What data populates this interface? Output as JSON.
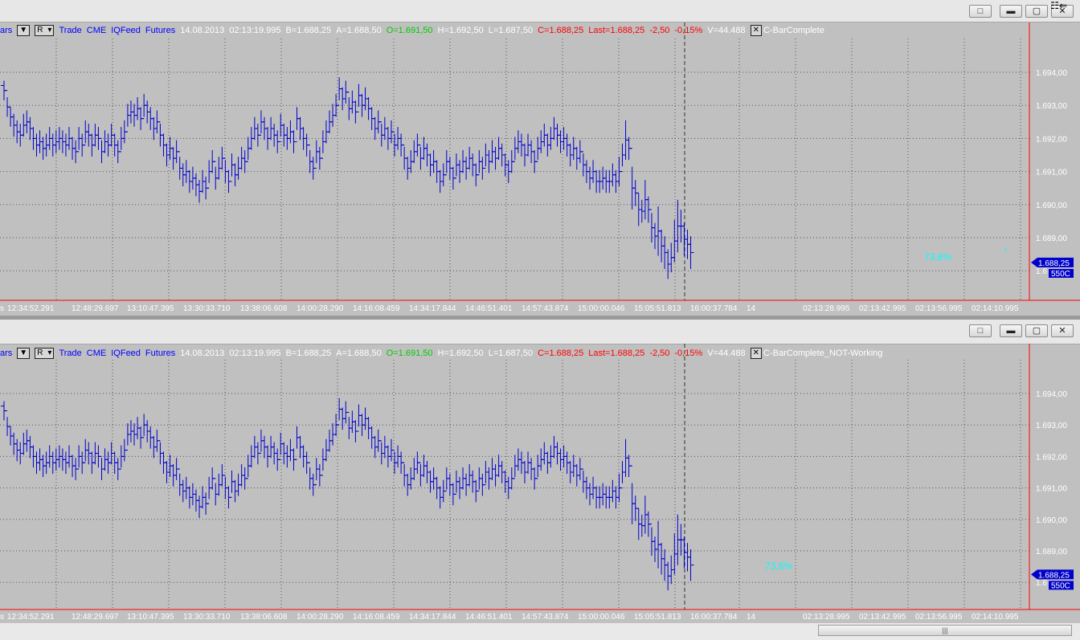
{
  "windows": [
    {
      "strategy_label": "C-BarComplete",
      "header": {
        "bars_label": "ars",
        "r_label": "R",
        "instrument": [
          "Trade",
          "CME",
          "IQFeed",
          "Futures"
        ],
        "date": "14.08.2013",
        "time": "02:13:19.995",
        "bid": "B=1.688,25",
        "ask": "A=1.688,50",
        "open": "O=1.691,50",
        "high": "H=1.692,50",
        "low": "L=1.687,50",
        "close": "C=1.688,25",
        "last": "Last=1.688,25",
        "change": "-2,50",
        "change_pct": "-0,15%",
        "volume": "V=44.488"
      },
      "price_tag": "1.688,25",
      "volume_tag": "550C",
      "percent_label": "73,6%"
    },
    {
      "strategy_label": "C-BarComplete_NOT-Working",
      "header": {
        "bars_label": "ars",
        "r_label": "R",
        "instrument": [
          "Trade",
          "CME",
          "IQFeed",
          "Futures"
        ],
        "date": "14.08.2013",
        "time": "02:13:19.995",
        "bid": "B=1.688,25",
        "ask": "A=1.688,50",
        "open": "O=1.691,50",
        "high": "H=1.692,50",
        "low": "L=1.687,50",
        "close": "C=1.688,25",
        "last": "Last=1.688,25",
        "change": "-2,50",
        "change_pct": "-0,15%",
        "volume": "V=44.488"
      },
      "price_tag": "1.688,25",
      "volume_tag": "550C",
      "percent_label": "73,6%"
    }
  ],
  "titlebar_icons": [
    "restore-icon",
    "minimize-icon",
    "maximize-icon",
    "close-icon"
  ],
  "colors": {
    "background": "#c0c0c0",
    "bars": "#0000cc",
    "axis": "#ff0000",
    "text_blue": "#0000ff",
    "text_green": "#00cc00",
    "text_red": "#ff0000",
    "text_white": "#ffffff",
    "percent": "#00ffff",
    "tag_bg": "#0000cc"
  },
  "chart_data": [
    {
      "type": "ohlc",
      "ylim": [
        1687.5,
        1694.4
      ],
      "y_ticks": [
        1689.0,
        1690.0,
        1691.0,
        1692.0,
        1693.0,
        1694.0
      ],
      "y_tick_labels": [
        "1.689,00",
        "1.690,00",
        "1.691,00",
        "1.692,00",
        "1.693,00",
        "1.694,00"
      ],
      "partial_tick_label": "1.6",
      "x_labels": [
        "12:34:52.291",
        "12:48:29.697",
        "13:10:47.395",
        "13:30:33.710",
        "13:38:06.608",
        "14:00:28.290",
        "14:16:08.459",
        "14:34:17.844",
        "14:46:51.401",
        "14:57:43.874",
        "15:00:00.046",
        "15:05:51.813",
        "16:00:37.784",
        "14",
        "02:13:28.995",
        "02:13:42.995",
        "02:13:56.995",
        "02:14:10.995"
      ],
      "x_label_prefix": "s",
      "session_break_after_bar": 121,
      "grid": true,
      "bars": [
        [
          1693.6,
          1693.3
        ],
        [
          1693.1,
          1692.8
        ],
        [
          1692.8,
          1692.5
        ],
        [
          1692.6,
          1692.2
        ],
        [
          1692.4,
          1692.0
        ],
        [
          1692.3,
          1691.9
        ],
        [
          1692.6,
          1692.2
        ],
        [
          1692.7,
          1692.3
        ],
        [
          1692.5,
          1692.1
        ],
        [
          1692.2,
          1691.8
        ],
        [
          1692.0,
          1691.6
        ],
        [
          1692.1,
          1691.7
        ],
        [
          1691.9,
          1691.5
        ],
        [
          1692.0,
          1691.6
        ],
        [
          1692.2,
          1691.8
        ],
        [
          1692.0,
          1691.6
        ],
        [
          1692.1,
          1691.7
        ],
        [
          1692.2,
          1691.8
        ],
        [
          1692.1,
          1691.7
        ],
        [
          1692.0,
          1691.6
        ],
        [
          1692.2,
          1691.8
        ],
        [
          1691.9,
          1691.5
        ],
        [
          1691.8,
          1691.4
        ],
        [
          1692.2,
          1691.8
        ],
        [
          1692.0,
          1691.6
        ],
        [
          1692.4,
          1692.0
        ],
        [
          1692.3,
          1691.9
        ],
        [
          1692.0,
          1691.6
        ],
        [
          1692.3,
          1691.9
        ],
        [
          1692.2,
          1691.8
        ],
        [
          1691.8,
          1691.4
        ],
        [
          1692.1,
          1691.7
        ],
        [
          1692.0,
          1691.6
        ],
        [
          1692.3,
          1691.9
        ],
        [
          1692.0,
          1691.6
        ],
        [
          1691.8,
          1691.4
        ],
        [
          1692.2,
          1691.8
        ],
        [
          1692.4,
          1692.0
        ],
        [
          1692.9,
          1692.5
        ],
        [
          1693.0,
          1692.6
        ],
        [
          1692.9,
          1692.5
        ],
        [
          1693.1,
          1692.7
        ],
        [
          1692.8,
          1692.4
        ],
        [
          1693.2,
          1692.8
        ],
        [
          1693.0,
          1692.6
        ],
        [
          1692.8,
          1692.4
        ],
        [
          1692.5,
          1692.1
        ],
        [
          1692.7,
          1692.3
        ],
        [
          1692.3,
          1691.9
        ],
        [
          1692.0,
          1691.6
        ],
        [
          1691.7,
          1691.3
        ],
        [
          1691.9,
          1691.5
        ],
        [
          1691.6,
          1691.2
        ],
        [
          1691.8,
          1691.4
        ],
        [
          1691.3,
          1690.9
        ],
        [
          1691.1,
          1690.7
        ],
        [
          1691.2,
          1690.8
        ],
        [
          1690.9,
          1690.5
        ],
        [
          1691.0,
          1690.6
        ],
        [
          1690.8,
          1690.4
        ],
        [
          1690.6,
          1690.2
        ],
        [
          1690.9,
          1690.5
        ],
        [
          1690.7,
          1690.3
        ],
        [
          1691.2,
          1690.8
        ],
        [
          1691.5,
          1691.1
        ],
        [
          1691.0,
          1690.6
        ],
        [
          1691.3,
          1690.9
        ],
        [
          1691.6,
          1691.2
        ],
        [
          1691.2,
          1690.8
        ],
        [
          1690.9,
          1690.5
        ],
        [
          1691.4,
          1691.0
        ],
        [
          1691.1,
          1690.7
        ],
        [
          1691.3,
          1690.9
        ],
        [
          1691.6,
          1691.2
        ],
        [
          1691.5,
          1691.1
        ],
        [
          1691.9,
          1691.5
        ],
        [
          1692.2,
          1691.8
        ],
        [
          1692.5,
          1692.1
        ],
        [
          1692.3,
          1691.9
        ],
        [
          1692.7,
          1692.3
        ],
        [
          1692.5,
          1692.1
        ],
        [
          1692.2,
          1691.8
        ],
        [
          1692.5,
          1692.1
        ],
        [
          1692.3,
          1691.9
        ],
        [
          1692.1,
          1691.7
        ],
        [
          1692.6,
          1692.2
        ],
        [
          1692.3,
          1691.9
        ],
        [
          1692.2,
          1691.8
        ],
        [
          1692.4,
          1692.0
        ],
        [
          1692.1,
          1691.7
        ],
        [
          1692.8,
          1692.4
        ],
        [
          1692.5,
          1692.1
        ],
        [
          1692.2,
          1691.8
        ],
        [
          1692.0,
          1691.6
        ],
        [
          1691.5,
          1691.1
        ],
        [
          1691.3,
          1690.9
        ],
        [
          1691.8,
          1691.4
        ],
        [
          1691.6,
          1691.2
        ],
        [
          1692.1,
          1691.7
        ],
        [
          1692.4,
          1692.0
        ],
        [
          1692.7,
          1692.3
        ],
        [
          1692.9,
          1692.5
        ],
        [
          1693.2,
          1692.8
        ],
        [
          1693.7,
          1693.3
        ],
        [
          1693.4,
          1693.0
        ],
        [
          1693.6,
          1693.2
        ],
        [
          1693.1,
          1692.7
        ],
        [
          1693.3,
          1692.9
        ],
        [
          1693.0,
          1692.6
        ],
        [
          1693.5,
          1693.1
        ],
        [
          1693.2,
          1692.8
        ],
        [
          1693.4,
          1693.0
        ],
        [
          1693.1,
          1692.7
        ],
        [
          1692.8,
          1692.4
        ],
        [
          1692.5,
          1692.1
        ],
        [
          1692.7,
          1692.3
        ],
        [
          1692.3,
          1691.9
        ],
        [
          1692.5,
          1692.1
        ],
        [
          1692.2,
          1691.8
        ],
        [
          1692.4,
          1692.0
        ],
        [
          1692.0,
          1691.6
        ],
        [
          1692.2,
          1691.8
        ]
      ],
      "bars_after_break": [
        [
          1692.0,
          1691.6
        ],
        [
          1691.6,
          1691.2
        ],
        [
          1691.3,
          1690.9
        ],
        [
          1691.5,
          1691.1
        ],
        [
          1691.8,
          1691.4
        ],
        [
          1692.0,
          1691.6
        ],
        [
          1691.6,
          1691.2
        ],
        [
          1691.9,
          1691.5
        ],
        [
          1691.7,
          1691.3
        ],
        [
          1691.4,
          1691.0
        ],
        [
          1691.5,
          1691.1
        ],
        [
          1691.2,
          1690.8
        ],
        [
          1690.9,
          1690.5
        ],
        [
          1691.1,
          1690.7
        ],
        [
          1691.5,
          1691.1
        ],
        [
          1691.3,
          1690.9
        ],
        [
          1691.0,
          1690.6
        ],
        [
          1691.4,
          1691.0
        ],
        [
          1691.2,
          1690.8
        ],
        [
          1691.5,
          1691.1
        ],
        [
          1691.3,
          1690.9
        ],
        [
          1691.6,
          1691.2
        ],
        [
          1691.4,
          1691.0
        ],
        [
          1691.1,
          1690.7
        ],
        [
          1691.5,
          1691.1
        ],
        [
          1691.3,
          1690.9
        ],
        [
          1691.7,
          1691.3
        ],
        [
          1691.5,
          1691.1
        ],
        [
          1691.8,
          1691.4
        ],
        [
          1691.6,
          1691.2
        ],
        [
          1691.9,
          1691.5
        ],
        [
          1691.7,
          1691.3
        ],
        [
          1691.4,
          1691.0
        ],
        [
          1691.2,
          1690.8
        ],
        [
          1691.5,
          1691.1
        ],
        [
          1691.9,
          1691.5
        ],
        [
          1692.1,
          1691.7
        ],
        [
          1692.0,
          1691.6
        ],
        [
          1691.7,
          1691.3
        ],
        [
          1692.0,
          1691.6
        ],
        [
          1691.8,
          1691.4
        ],
        [
          1691.5,
          1691.1
        ],
        [
          1691.9,
          1691.5
        ],
        [
          1692.1,
          1691.7
        ],
        [
          1692.3,
          1691.9
        ],
        [
          1692.0,
          1691.6
        ],
        [
          1692.2,
          1691.8
        ],
        [
          1692.5,
          1692.1
        ],
        [
          1692.3,
          1691.9
        ],
        [
          1692.1,
          1691.7
        ],
        [
          1692.2,
          1691.8
        ],
        [
          1692.0,
          1691.6
        ],
        [
          1691.7,
          1691.3
        ],
        [
          1691.9,
          1691.5
        ],
        [
          1691.6,
          1691.2
        ],
        [
          1691.8,
          1691.4
        ],
        [
          1691.4,
          1691.0
        ],
        [
          1691.2,
          1690.8
        ],
        [
          1691.0,
          1690.6
        ],
        [
          1691.2,
          1690.8
        ],
        [
          1690.9,
          1690.5
        ],
        [
          1690.9,
          1690.5
        ],
        [
          1691.0,
          1690.6
        ],
        [
          1690.9,
          1690.5
        ],
        [
          1690.9,
          1690.5
        ],
        [
          1691.1,
          1690.7
        ],
        [
          1690.9,
          1690.5
        ],
        [
          1691.3,
          1690.7
        ],
        [
          1691.7,
          1691.3
        ],
        [
          1692.4,
          1691.5
        ],
        [
          1691.9,
          1691.5
        ],
        [
          1691.0,
          1690.0
        ],
        [
          1690.6,
          1690.1
        ],
        [
          1690.2,
          1689.5
        ],
        [
          1690.0,
          1689.6
        ],
        [
          1690.6,
          1689.7
        ],
        [
          1690.1,
          1689.6
        ],
        [
          1689.6,
          1689.0
        ],
        [
          1689.3,
          1688.8
        ],
        [
          1689.8,
          1688.6
        ],
        [
          1689.1,
          1688.4
        ],
        [
          1688.9,
          1688.2
        ],
        [
          1688.5,
          1687.9
        ],
        [
          1688.7,
          1688.1
        ],
        [
          1689.4,
          1688.4
        ],
        [
          1690.0,
          1688.7
        ],
        [
          1689.7,
          1689.0
        ],
        [
          1689.3,
          1688.6
        ],
        [
          1689.1,
          1688.5
        ],
        [
          1688.9,
          1688.2
        ]
      ]
    }
  ]
}
